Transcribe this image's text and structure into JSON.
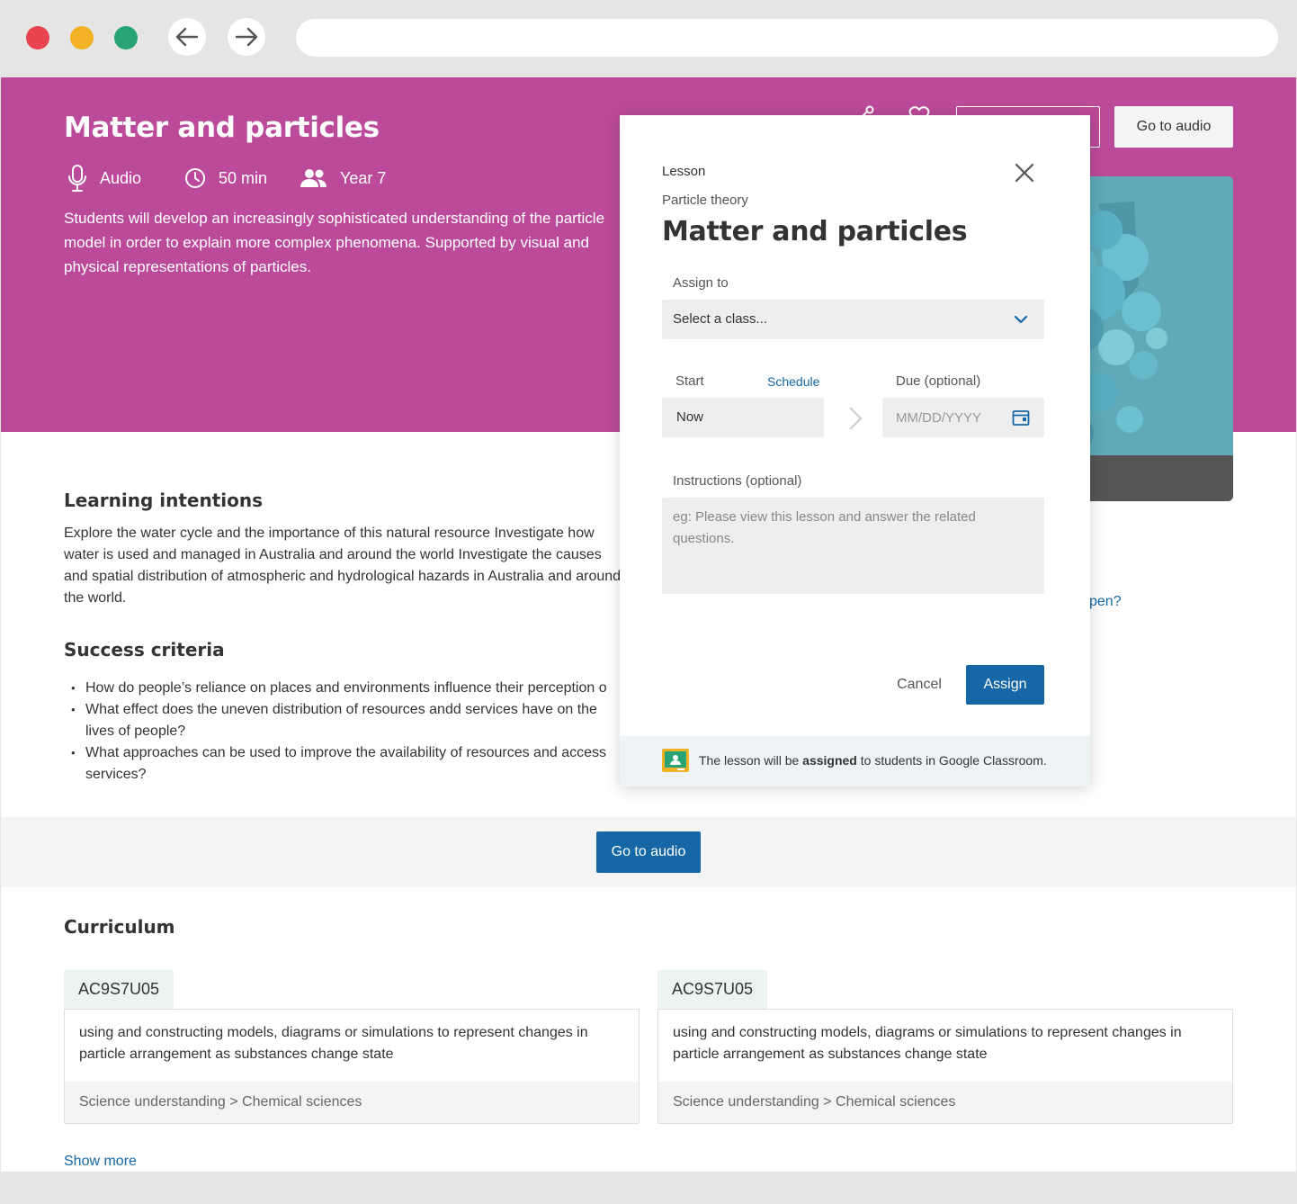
{
  "hero": {
    "title": "Matter and particles",
    "meta_audio": "Audio",
    "meta_duration": "50 min",
    "meta_year": "Year 7",
    "description": "Students will develop an increasingly sophisticated understanding of the particle model in order to explain more complex phenomena. Supported by visual and physical representations of particles.",
    "go_to_audio": "Go to audio",
    "color": "#bb4a9b"
  },
  "learning": {
    "title": "Learning intentions",
    "text": "Explore the water cycle and the importance of this natural resource Investigate how water is used and managed in Australia and around the world Investigate the causes and spatial distribution of atmospheric and hydrological hazards in Australia and around the world."
  },
  "success": {
    "title": "Success criteria",
    "items": [
      "How do people’s reliance on places and environments influence their perception o",
      "What effect does the uneven distribution of resources andd services have on the lives of people?",
      "What approaches can be used to improve the availability of resources and access services?"
    ]
  },
  "link_fragment": "pen?",
  "cta": {
    "label": "Go to audio"
  },
  "curriculum": {
    "title": "Curriculum",
    "cards": [
      {
        "code": "AC9S7U05",
        "text": "using and constructing models, diagrams or simulations to represent changes in particle arrangement as substances change state",
        "path": "Science understanding > Chemical sciences"
      },
      {
        "code": "AC9S7U05",
        "text": "using and constructing models, diagrams or simulations to represent changes in particle arrangement as substances change state",
        "path": "Science understanding > Chemical sciences"
      }
    ],
    "show_more": "Show more"
  },
  "modal": {
    "kicker": "Lesson",
    "subtitle": "Particle theory",
    "title": "Matter and particles",
    "assign_to_label": "Assign to",
    "select_value": "Select a class...",
    "start_label": "Start",
    "schedule_link": "Schedule",
    "start_value": "Now",
    "due_label": "Due (optional)",
    "due_placeholder": "MM/DD/YYYY",
    "instructions_label": "Instructions (optional)",
    "instructions_placeholder": "eg: Please view this lesson and answer the related questions.",
    "cancel": "Cancel",
    "assign": "Assign",
    "footer_pre": "The lesson will be ",
    "footer_bold": "assigned",
    "footer_post": " to students in Google Classroom."
  },
  "colors": {
    "primary": "#1568a5",
    "hero": "#bb4a9b",
    "code_bg": "#e9f5ee"
  },
  "icons": [
    "back-arrow-icon",
    "forward-arrow-icon",
    "microphone-icon",
    "clock-icon",
    "people-icon",
    "share-icon",
    "heart-icon",
    "close-icon",
    "chevron-down-icon",
    "chevron-right-icon",
    "calendar-icon",
    "google-classroom-icon"
  ]
}
